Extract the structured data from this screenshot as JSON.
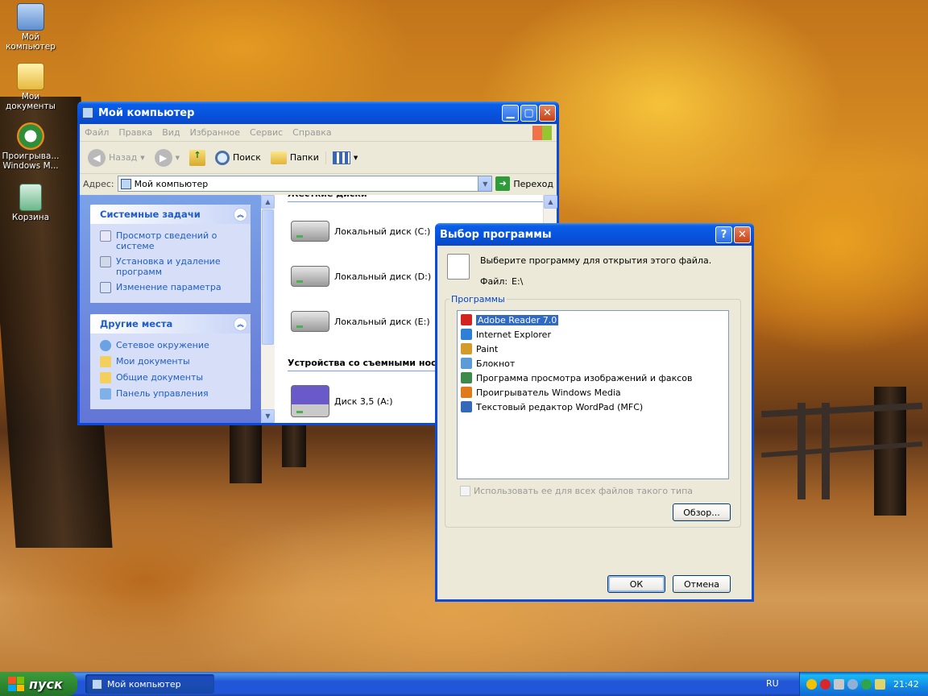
{
  "desktop": {
    "icons": [
      {
        "label": "Мой компьютер",
        "icon": "computer-icon"
      },
      {
        "label": "Мои документы",
        "icon": "documents-icon"
      },
      {
        "label": "Проигрыва... Windows M...",
        "icon": "media-player-icon"
      },
      {
        "label": "Корзина",
        "icon": "recycle-bin-icon"
      }
    ]
  },
  "explorer": {
    "title": "Мой компьютер",
    "menu": [
      "Файл",
      "Правка",
      "Вид",
      "Избранное",
      "Сервис",
      "Справка"
    ],
    "toolbar": {
      "back": "Назад",
      "search": "Поиск",
      "folders": "Папки"
    },
    "address": {
      "label": "Адрес:",
      "value": "Мой компьютер",
      "go": "Переход"
    },
    "system_tasks": {
      "title": "Системные задачи",
      "items": [
        "Просмотр сведений о системе",
        "Установка и удаление программ",
        "Изменение параметра"
      ]
    },
    "other_places": {
      "title": "Другие места",
      "items": [
        "Сетевое окружение",
        "Мои документы",
        "Общие документы",
        "Панель управления"
      ]
    },
    "sections": {
      "hard_drives": "Жесткие диски",
      "removable": "Устройства со съемными носите"
    },
    "drives": [
      "Локальный диск (C:)",
      "Локальный диск (D:)",
      "Локальный диск (E:)"
    ],
    "removable_drives": [
      "Диск 3,5 (A:)"
    ]
  },
  "dialog": {
    "title": "Выбор программы",
    "prompt": "Выберите программу для открытия этого файла.",
    "file_label": "Файл:",
    "file_value": "E:\\",
    "group_label": "Программы",
    "programs": [
      {
        "name": "Adobe Reader 7.0",
        "color": "#d2231f",
        "selected": true
      },
      {
        "name": "Internet Explorer",
        "color": "#2f7fd8",
        "selected": false
      },
      {
        "name": "Paint",
        "color": "#d59b2a",
        "selected": false
      },
      {
        "name": "Блокнот",
        "color": "#5a9bd8",
        "selected": false
      },
      {
        "name": "Программа просмотра изображений и факсов",
        "color": "#3e8a4a",
        "selected": false
      },
      {
        "name": "Проигрыватель Windows Media",
        "color": "#e07b1a",
        "selected": false
      },
      {
        "name": "Текстовый редактор WordPad (MFC)",
        "color": "#3468b8",
        "selected": false
      }
    ],
    "checkbox_label": "Использовать ее для всех файлов такого типа",
    "browse": "Обзор...",
    "ok": "ОК",
    "cancel": "Отмена"
  },
  "taskbar": {
    "start": "пуск",
    "task": "Мой компьютер",
    "lang": "RU",
    "clock": "21:42"
  }
}
